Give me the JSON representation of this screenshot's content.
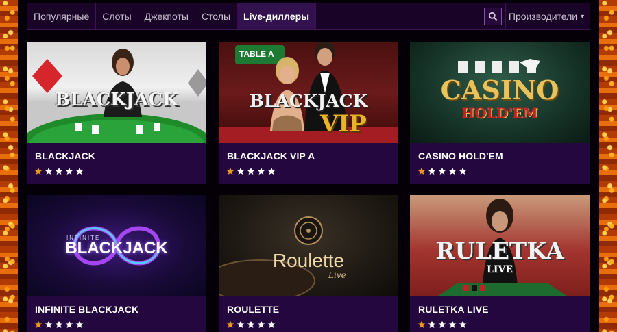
{
  "nav": {
    "tabs": [
      {
        "label": "Популярные"
      },
      {
        "label": "Слоты"
      },
      {
        "label": "Джекпоты"
      },
      {
        "label": "Столы"
      },
      {
        "label": "Live-диллеры",
        "active": true
      }
    ],
    "search_icon": "search-icon",
    "providers_label": "Производители"
  },
  "games": [
    {
      "title": "BLACKJACK",
      "logo": "BLACKJACK",
      "rating": 1,
      "max_rating": 5
    },
    {
      "title": "BLACKJACK VIP A",
      "logo": "BLACKJACK",
      "logo_sub": "VIP",
      "badge": "TABLE A",
      "rating": 1,
      "max_rating": 5
    },
    {
      "title": "CASINO HOLD'EM",
      "logo": "CASINO",
      "logo_sub": "HOLD'EM",
      "rating": 1,
      "max_rating": 5
    },
    {
      "title": "INFINITE BLACKJACK",
      "logo": "BLACKJACK",
      "logo_small": "INFINITE",
      "rating": 1,
      "max_rating": 5
    },
    {
      "title": "ROULETTE",
      "logo": "Roulette",
      "logo_sub": "Live",
      "rating": 1,
      "max_rating": 5
    },
    {
      "title": "RULETKA LIVE",
      "logo": "RULETKA",
      "logo_sub": "LIVE",
      "rating": 1,
      "max_rating": 5
    }
  ],
  "colors": {
    "star_active": "#f0961e",
    "star_inactive": "#ffffff",
    "card_bg": "#25073f",
    "nav_active": "#33104e"
  }
}
